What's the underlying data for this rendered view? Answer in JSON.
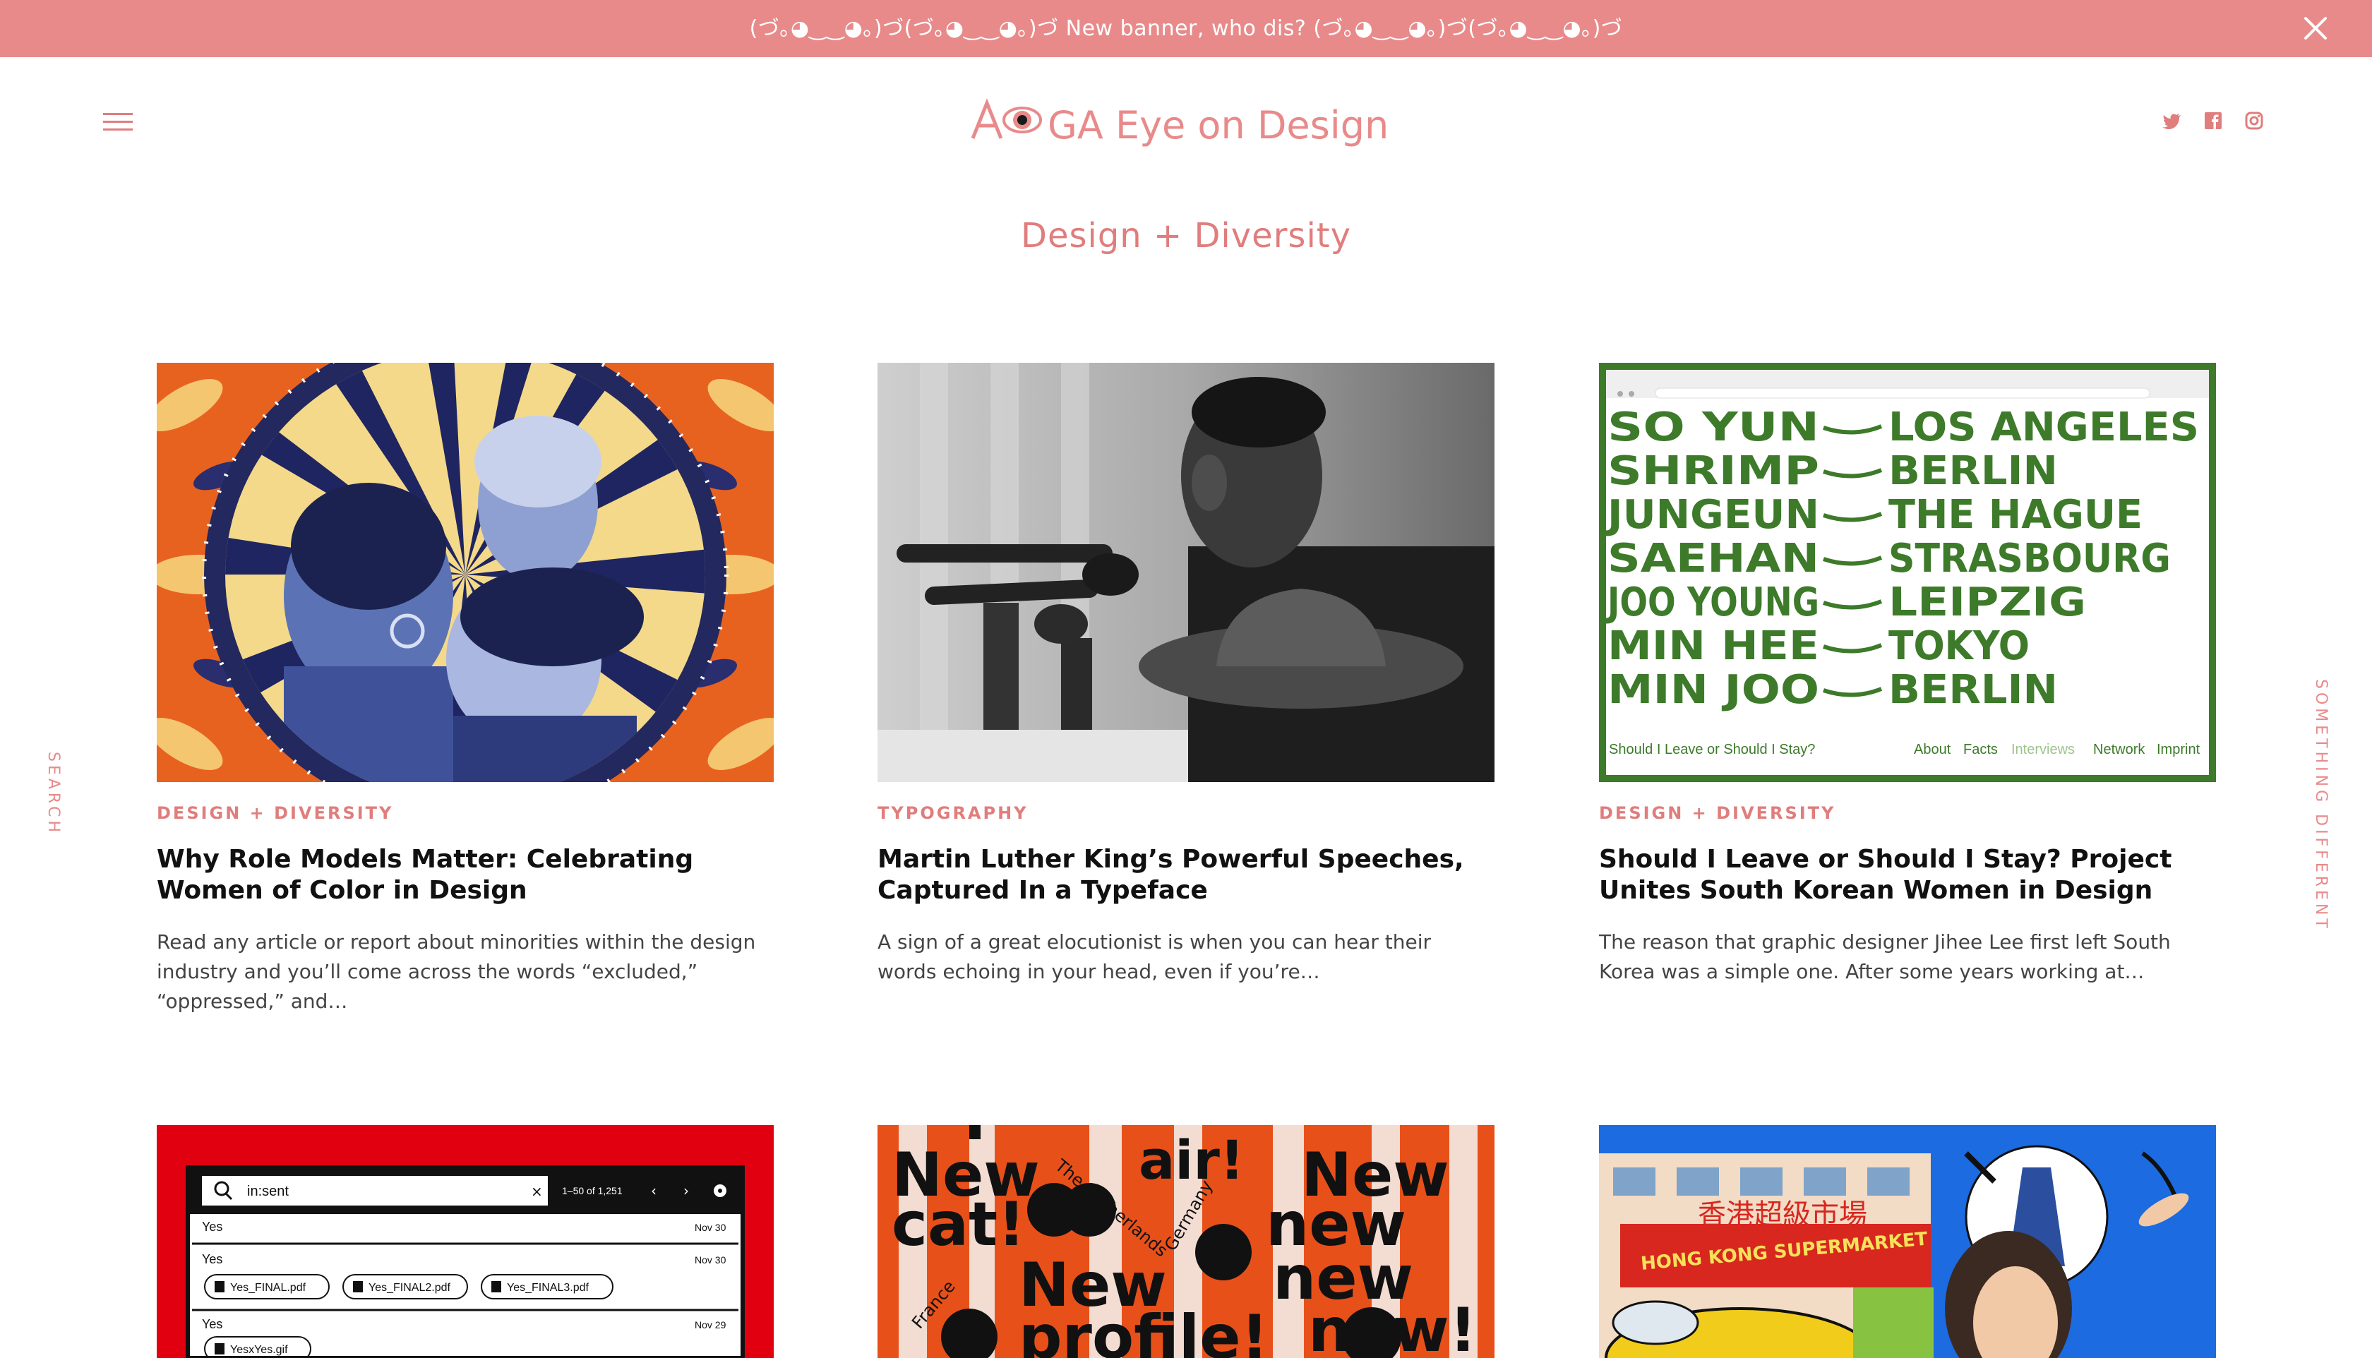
{
  "banner": {
    "text": "(づ｡◕‿‿◕｡)づ(づ｡◕‿‿◕｡)づ New banner, who dis? (づ｡◕‿‿◕｡)づ(づ｡◕‿‿◕｡)づ",
    "close_icon": "close-icon",
    "background": "#e98a8a"
  },
  "header": {
    "logo": {
      "text": "AIGA Eye on Design"
    },
    "menu_icon": "hamburger-icon",
    "social": [
      "twitter-icon",
      "facebook-icon",
      "instagram-icon"
    ]
  },
  "page": {
    "category_title": "Design + Diversity",
    "accent_color": "#e07d7d"
  },
  "side_links": {
    "search": "SEARCH",
    "different": "SOMETHING DIFFERENT"
  },
  "articles": [
    {
      "category": "DESIGN + DIVERSITY",
      "title": "Why Role Models Matter: Celebrating Women of Color in Design",
      "excerpt": "Read any article or report about minorities within the design industry and you’ll come across the words “excluded,” “oppressed,” and…"
    },
    {
      "category": "TYPOGRAPHY",
      "title": "Martin Luther King’s Powerful Speeches, Captured In a Typeface",
      "excerpt": "A sign of a great elocutionist is when you can hear their words echoing in your head, even if you’re…"
    },
    {
      "category": "DESIGN + DIVERSITY",
      "title": "Should I Leave or Should I Stay? Project Unites South Korean Women in Design",
      "excerpt": "The reason that graphic designer Jihee Lee first left South Korea was a simple one. After some years working at…",
      "image_text": {
        "rows": [
          [
            "SO YUN",
            "LOS ANGELES"
          ],
          [
            "SHRIMP",
            "BERLIN"
          ],
          [
            "JUNGEUN",
            "THE HAGUE"
          ],
          [
            "SAEHAN",
            "STRASBOURG"
          ],
          [
            "JOO YOUNG",
            "LEIPZIG"
          ],
          [
            "MIN HEE",
            "TOKYO"
          ],
          [
            "MIN JOO",
            "BERLIN"
          ]
        ],
        "footer_left": "Should I Leave or Should I Stay?",
        "footer_nav": [
          "About",
          "Facts",
          "Interviews",
          "Network",
          "Imprint"
        ]
      }
    }
  ],
  "row2_images": {
    "gmail": {
      "search_value": "in:sent",
      "range": "1–50 of 1,251",
      "rows": [
        {
          "sender": "Yes",
          "date": "Nov 30",
          "attachments": []
        },
        {
          "sender": "Yes",
          "date": "Nov 30",
          "attachments": [
            "Yes_FINAL.pdf",
            "Yes_FINAL2.pdf",
            "Yes_FINAL3.pdf"
          ]
        },
        {
          "sender": "Yes",
          "date": "Nov 29",
          "attachments": [
            "YesxYes.gif"
          ]
        }
      ]
    },
    "poster": {
      "words": [
        "New",
        "cat!",
        "air!",
        "New",
        "new",
        "new",
        "New",
        "profile!",
        "now!"
      ],
      "curved": [
        "The Netherlands",
        "Germany",
        "France"
      ]
    },
    "illustration": {
      "sign_chinese": "香港超級市場",
      "sign": "HONG KONG SUPERMARKET"
    }
  }
}
